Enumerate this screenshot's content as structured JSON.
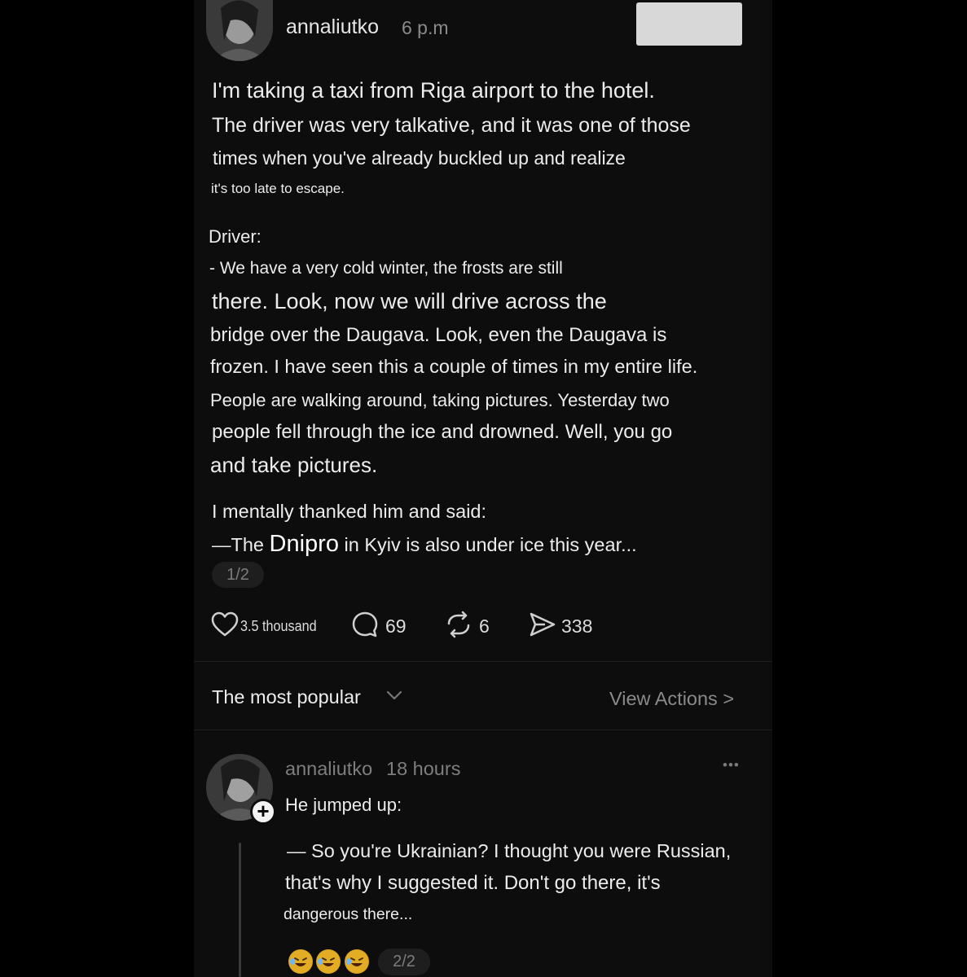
{
  "post": {
    "username": "annaliutko",
    "time": "6 p.m",
    "lines": [
      "I'm taking a taxi from Riga airport to the hotel.",
      "The driver was very talkative, and it was one of those",
      "times when you've already buckled up and realize",
      "it's too late to escape.",
      "Driver:",
      "- We have a very cold winter, the frosts are still",
      "there. Look, now we will drive across the",
      "bridge over the Daugava. Look, even the Daugava is",
      "frozen. I have seen this a couple of times in my entire life.",
      "People are walking around, taking pictures. Yesterday two",
      "people fell through the ice and drowned. Well, you go",
      "and take pictures.",
      "I mentally thanked him and said:"
    ],
    "last_line": {
      "dash": "—",
      "pre": "The ",
      "highlight": "Dnipro",
      "post": " in Kyiv is also under ice this year..."
    },
    "pager": "1/2"
  },
  "stats": {
    "likes": "3.5 thousand",
    "comments": "69",
    "reposts": "6",
    "shares": "338"
  },
  "filter": {
    "label": "The most popular",
    "view_actions": "View Actions >"
  },
  "reply": {
    "username": "annaliutko",
    "time": "18 hours",
    "more": "•••",
    "lines": [
      "He jumped up:",
      "— So you're Ukrainian? I thought you were Russian,",
      "that's why I suggested it. Don't go there, it's",
      "dangerous there..."
    ],
    "pager": "2/2"
  },
  "icons": [
    "heart-icon",
    "comment-icon",
    "repost-icon",
    "share-icon",
    "chevron-down-icon",
    "plus-icon",
    "more-icon",
    "laughing-emoji-icon"
  ]
}
